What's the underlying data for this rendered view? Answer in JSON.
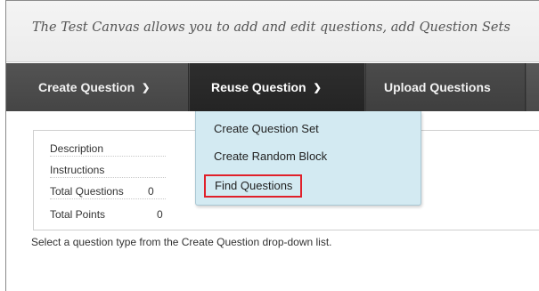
{
  "intro": {
    "text": "The Test Canvas allows you to add and edit questions, add Question Sets"
  },
  "toolbar": {
    "create_label": "Create Question",
    "reuse_label": "Reuse Question",
    "upload_label": "Upload Questions"
  },
  "dropdown": {
    "items": [
      {
        "label": "Create Question Set"
      },
      {
        "label": "Create Random Block"
      },
      {
        "label": "Find Questions"
      }
    ],
    "highlight_color": "#e0202a"
  },
  "summary": {
    "rows": [
      {
        "label": "Description",
        "value": ""
      },
      {
        "label": "Instructions",
        "value": ""
      },
      {
        "label": "Total Questions",
        "value": "0"
      },
      {
        "label": "Total Points",
        "value": "0"
      }
    ]
  },
  "hint": "Select a question type from the Create Question drop-down list.",
  "colors": {
    "toolbar": "#444444",
    "dropdown_bg": "#d3eaf2"
  },
  "icons": {
    "menu_chevron": "chevron-down-icon"
  }
}
